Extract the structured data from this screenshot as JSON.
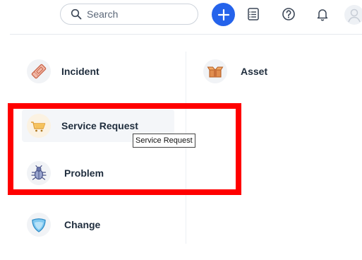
{
  "header": {
    "search_placeholder": "Search",
    "icons": [
      "search-icon",
      "plus-icon",
      "checklist-icon",
      "help-icon",
      "bell-icon",
      "avatar-icon"
    ],
    "accent_color": "#2563eb"
  },
  "menu": {
    "left": [
      {
        "label": "Incident",
        "icon": "ticket-icon"
      },
      {
        "label": "Service Request",
        "icon": "cart-icon"
      },
      {
        "label": "Problem",
        "icon": "bug-icon"
      },
      {
        "label": "Change",
        "icon": "shield-icon"
      }
    ],
    "right": [
      {
        "label": "Asset",
        "icon": "box-icon"
      }
    ]
  },
  "tooltip": {
    "text": "Service Request"
  },
  "highlight_color": "#ff0000"
}
